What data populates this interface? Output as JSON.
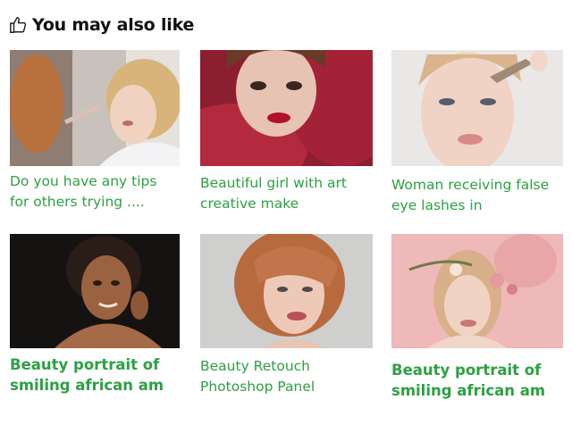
{
  "header": {
    "title": "You may also like",
    "icon": "thumbs-up-icon"
  },
  "accent_color": "#2ea043",
  "cards": [
    {
      "caption_lines": [
        "Do you have any tips",
        "for others trying ...."
      ],
      "image": "bridal-makeup-photo"
    },
    {
      "caption_lines": [
        "Beautiful girl with art",
        "creative make"
      ],
      "image": "red-tulle-portrait-photo"
    },
    {
      "caption_lines": [
        "Woman receiving false",
        "eye lashes in"
      ],
      "image": "eyelash-application-photo"
    },
    {
      "caption_lines": [
        "Beauty portrait of",
        "smiling african am"
      ],
      "image": "african-beauty-portrait-photo"
    },
    {
      "caption_lines": [
        "Beauty Retouch",
        "Photoshop Panel"
      ],
      "image": "redhead-retouch-photo"
    },
    {
      "caption_lines": [
        "Beauty portrait of",
        "smiling african am"
      ],
      "image": "flower-crown-portrait-photo"
    }
  ]
}
